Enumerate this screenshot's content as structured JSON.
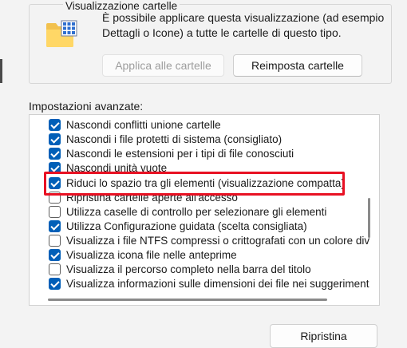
{
  "folder_view": {
    "title": "Visualizzazione cartelle",
    "description": "È possibile applicare questa visualizzazione (ad esempio Dettagli o Icone) a tutte le cartelle di questo tipo.",
    "apply_button": "Applica alle cartelle",
    "reset_button": "Reimposta cartelle",
    "icon": "folder-view-icon"
  },
  "advanced": {
    "label": "Impostazioni avanzate:",
    "items": [
      {
        "label": "Nascondi conflitti unione cartelle",
        "checked": true
      },
      {
        "label": "Nascondi i file protetti di sistema (consigliato)",
        "checked": true
      },
      {
        "label": "Nascondi le estensioni per i tipi di file conosciuti",
        "checked": true
      },
      {
        "label": "Nascondi unità vuote",
        "checked": true
      },
      {
        "label": "Riduci lo spazio tra gli elementi (visualizzazione compatta)",
        "checked": true
      },
      {
        "label": "Ripristina cartelle aperte all'accesso",
        "checked": false
      },
      {
        "label": "Utilizza caselle di controllo per selezionare gli elementi",
        "checked": false
      },
      {
        "label": "Utilizza Configurazione guidata (scelta consigliata)",
        "checked": true
      },
      {
        "label": "Visualizza i file NTFS compressi o crittografati con un colore div",
        "checked": false
      },
      {
        "label": "Visualizza icona file nelle anteprime",
        "checked": true
      },
      {
        "label": "Visualizza il percorso completo nella barra del titolo",
        "checked": false
      },
      {
        "label": "Visualizza informazioni sulle dimensioni dei file nei suggeriment",
        "checked": true
      }
    ],
    "highlighted_index": 4
  },
  "footer": {
    "restore_button": "Ripristina"
  },
  "colors": {
    "accent": "#005fb8",
    "highlight": "#e81123"
  }
}
